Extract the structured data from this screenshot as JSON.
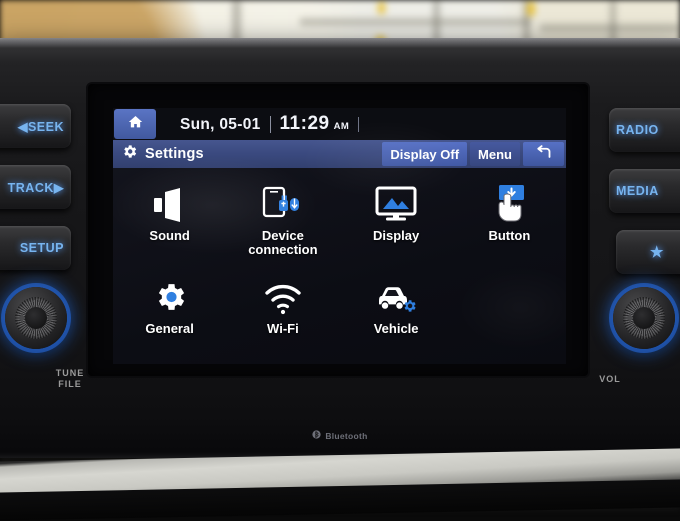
{
  "device": {
    "brand_logo": "Bluetooth",
    "bluetooth_icon": "bluetooth-icon"
  },
  "screen": {
    "statusbar": {
      "home_icon": "home-icon",
      "date": "Sun, 05-01",
      "time": "11:29",
      "ampm": "AM"
    },
    "titlebar": {
      "gear_icon": "gear-icon",
      "title": "Settings",
      "display_off_label": "Display Off",
      "menu_label": "Menu",
      "back_icon": "back-arrow-icon"
    },
    "menu": {
      "row1": [
        {
          "label": "Sound",
          "icon": "speaker-icon"
        },
        {
          "label": "Device\nconnection",
          "label_line1": "Device",
          "label_line2": "connection",
          "icon": "device-connection-icon"
        },
        {
          "label": "Display",
          "icon": "display-monitor-icon"
        },
        {
          "label": "Button",
          "icon": "button-press-icon"
        }
      ],
      "row2": [
        {
          "label": "General",
          "icon": "general-gear-icon"
        },
        {
          "label": "Wi-Fi",
          "icon": "wifi-icon"
        },
        {
          "label": "Vehicle",
          "icon": "vehicle-gear-icon"
        }
      ]
    }
  },
  "hard_buttons": {
    "left": [
      {
        "label": "◀SEEK",
        "name": "seek-button"
      },
      {
        "label": "TRACK▶",
        "name": "track-button"
      },
      {
        "label": "SETUP",
        "name": "setup-button"
      }
    ],
    "right": [
      {
        "label": "RADIO",
        "name": "radio-button"
      },
      {
        "label": "MEDIA",
        "name": "media-button"
      },
      {
        "label": "★",
        "name": "favorite-button"
      }
    ]
  },
  "knobs": {
    "left": {
      "line1": "TUNE",
      "line2": "FILE"
    },
    "right": {
      "line1": "VOL",
      "line2": ""
    }
  },
  "colors": {
    "accent_blue": "#4a63b4",
    "button_blue": "#5771c5",
    "icon_blue": "#2f7fe0",
    "led_blue": "#77b4ef",
    "screen_bg": "#101119"
  }
}
